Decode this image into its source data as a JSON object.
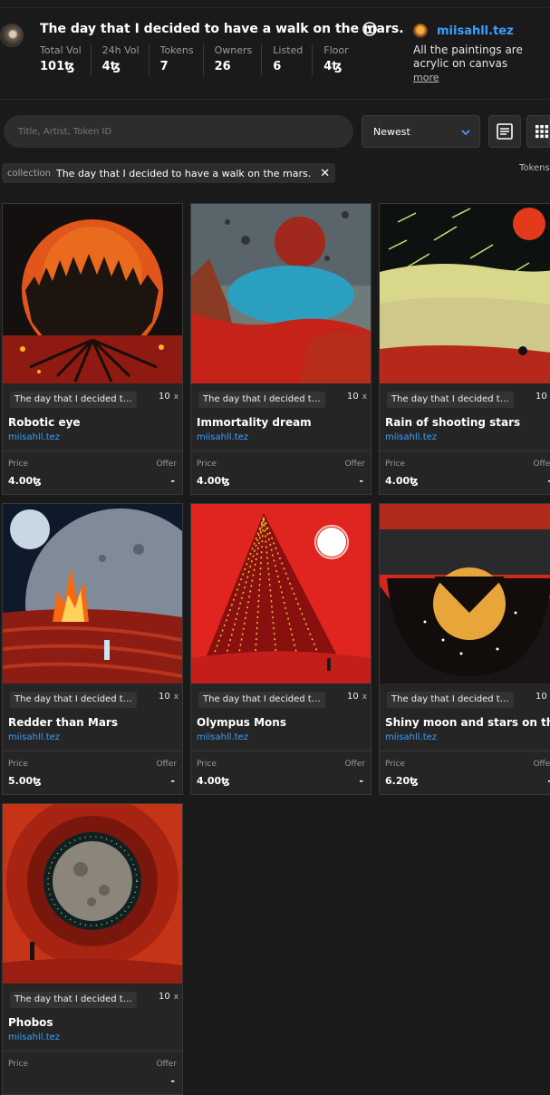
{
  "collection": {
    "title": "The day that I decided to have a walk on the mars.",
    "stats": [
      {
        "label": "Total Vol",
        "value": "101ꜩ"
      },
      {
        "label": "24h Vol",
        "value": "4ꜩ"
      },
      {
        "label": "Tokens",
        "value": "7"
      },
      {
        "label": "Owners",
        "value": "26"
      },
      {
        "label": "Listed",
        "value": "6"
      },
      {
        "label": "Floor",
        "value": "4ꜩ"
      }
    ]
  },
  "artist": {
    "name": "miisahll.tez",
    "description": "All the paintings are acrylic on canvas",
    "more_label": "more"
  },
  "filters": {
    "search_placeholder": "Title, Artist, Token ID",
    "sort_value": "Newest",
    "chip_key": "collection",
    "chip_value": "The day that I decided to have a walk on the mars.",
    "tokens_label": "Tokens"
  },
  "cards": [
    {
      "collection": "The day that I decided to have a walk on the mars.",
      "editions": "10",
      "name": "Robotic eye",
      "creator": "miisahll.tez",
      "price_label": "Price",
      "offer_label": "Offer",
      "price": "4.00ꜩ",
      "offer": "-"
    },
    {
      "collection": "The day that I decided to have a walk on the mars.",
      "editions": "10",
      "name": "Immortality dream",
      "creator": "miisahll.tez",
      "price_label": "Price",
      "offer_label": "Offer",
      "price": "4.00ꜩ",
      "offer": "-"
    },
    {
      "collection": "The day that I decided to have a walk on the mars.",
      "editions": "10",
      "name": "Rain of shooting stars",
      "creator": "miisahll.tez",
      "price_label": "Price",
      "offer_label": "Offer",
      "price": "4.00ꜩ",
      "offer": "-"
    },
    {
      "collection": "The day that I decided to have a walk on the mars.",
      "editions": "10",
      "name": "Redder than Mars",
      "creator": "miisahll.tez",
      "price_label": "Price",
      "offer_label": "Offer",
      "price": "5.00ꜩ",
      "offer": "-"
    },
    {
      "collection": "The day that I decided to have a walk on the mars.",
      "editions": "10",
      "name": "Olympus Mons",
      "creator": "miisahll.tez",
      "price_label": "Price",
      "offer_label": "Offer",
      "price": "4.00ꜩ",
      "offer": "-"
    },
    {
      "collection": "The day that I decided to have a walk on the mars.",
      "editions": "10",
      "name": "Shiny moon and stars on the mars",
      "creator": "miisahll.tez",
      "price_label": "Price",
      "offer_label": "Offer",
      "price": "6.20ꜩ",
      "offer": "-"
    },
    {
      "collection": "The day that I decided to have a walk on the mars.",
      "editions": "10",
      "name": "Phobos",
      "creator": "miisahll.tez",
      "price_label": "Price",
      "offer_label": "Offer",
      "price": "",
      "offer": "-"
    }
  ]
}
